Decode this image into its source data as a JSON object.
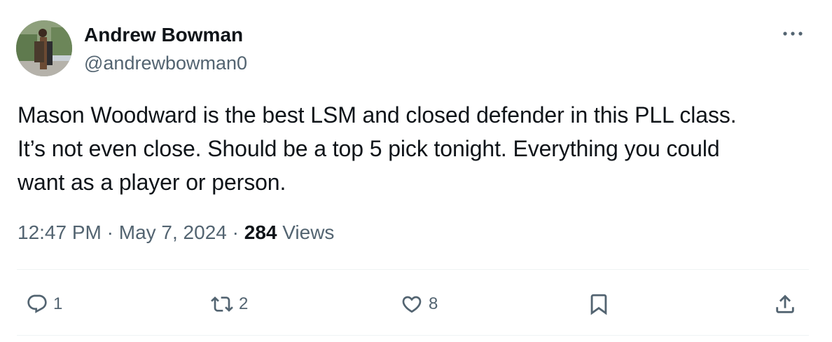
{
  "author": {
    "name": "Andrew Bowman",
    "handle": "@andrewbowman0"
  },
  "tweet": {
    "text": "Mason Woodward is the best LSM and closed defender in this PLL class.\nIt’s not even close. Should be a top 5 pick tonight. Everything you could\nwant as a player or person.",
    "time": "12:47 PM",
    "separator": "·",
    "date": "May 7, 2024",
    "views_count": "284",
    "views_label": "Views"
  },
  "actions": {
    "replies": "1",
    "reposts": "2",
    "likes": "8"
  },
  "icons": {
    "more": "more-horizontal-icon",
    "reply": "reply-icon",
    "repost": "repost-icon",
    "like": "heart-icon",
    "bookmark": "bookmark-icon",
    "share": "share-icon"
  },
  "colors": {
    "text_primary": "#0f1419",
    "text_secondary": "#536471",
    "divider": "#eff3f4"
  }
}
